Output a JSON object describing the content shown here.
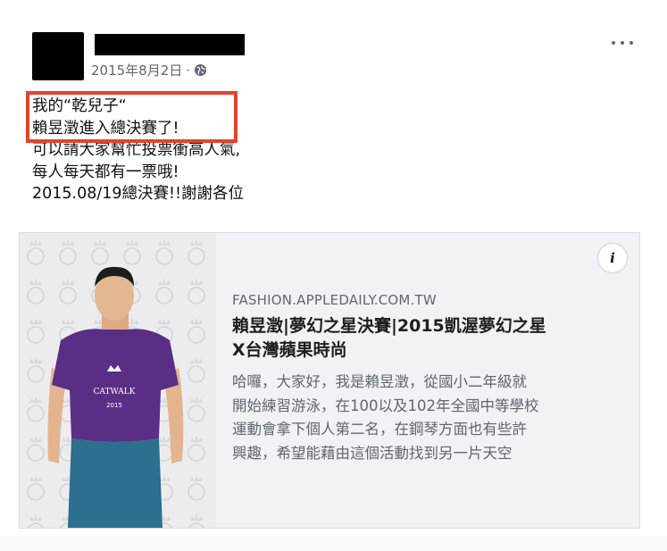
{
  "post": {
    "timestamp": "2015年8月2日",
    "separator": "·",
    "privacy_icon": "globe-icon",
    "more_icon": "more-options-icon",
    "text_lines": [
      "我的“乾兒子“",
      "賴昱澂進入總決賽了!",
      "可以請大家幫忙投票衝高人氣,",
      "每人每天都有一票哦!",
      "2015.08/19總決賽!!謝謝各位"
    ],
    "highlight_color": "#e0452e"
  },
  "link_card": {
    "domain": "FASHION.APPLEDAILY.COM.TW",
    "title_lines": [
      "賴昱澂|夢幻之星決賽|2015凱渥夢幻之星",
      "X台灣蘋果時尚"
    ],
    "description_lines": [
      "哈囉，大家好，我是賴昱澂，從國小二年級就",
      "開始練習游泳，在100以及102年全國中等學校",
      "運動會拿下個人第二名，在鋼琴方面也有些許",
      "興趣，希望能藉由這個活動找到另一片天空"
    ],
    "info_label": "i",
    "image": {
      "shirt_text_1": "CATWALK",
      "shirt_text_2": "2015",
      "shirt_color": "#5b2e86",
      "jeans_color": "#2d6f8e"
    }
  }
}
